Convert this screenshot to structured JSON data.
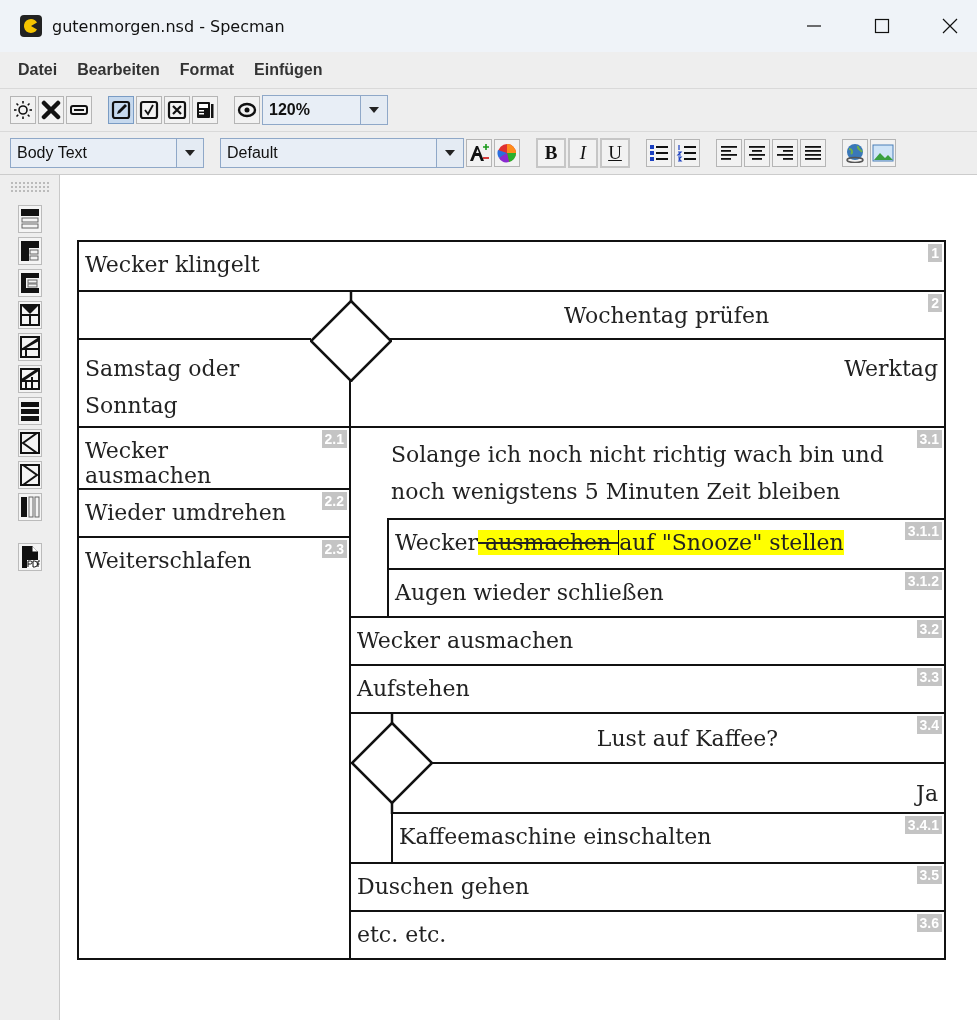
{
  "window": {
    "title": "gutenmorgen.nsd - Specman"
  },
  "menu": [
    "Datei",
    "Bearbeiten",
    "Format",
    "Einfügen"
  ],
  "toolbar": {
    "tools": [
      {
        "selected": false
      },
      {
        "selected": false
      },
      {
        "selected": false
      },
      {
        "selected": true
      },
      {
        "selected": false
      },
      {
        "selected": false
      },
      {
        "selected": false
      },
      {
        "selected": false
      }
    ],
    "zoom": "120%"
  },
  "format_bar": {
    "paragraph_style": "Body Text",
    "font": "Default",
    "style_buttons": [
      "B",
      "I",
      "U"
    ]
  },
  "diagram": {
    "blocks": [
      {
        "kind": "action",
        "number": "1",
        "text": "Wecker klingelt"
      },
      {
        "kind": "branch",
        "number": "2",
        "question": "Wochentag prüfen",
        "left_label": "Samstag oder Sonntag",
        "right_label": "Werktag",
        "left": [
          {
            "kind": "action",
            "number": "2.1",
            "text": "Wecker ausmachen"
          },
          {
            "kind": "action",
            "number": "2.2",
            "text": "Wieder umdrehen"
          },
          {
            "kind": "action",
            "number": "2.3",
            "text": "Weiterschlafen"
          }
        ],
        "right": [
          {
            "kind": "loop",
            "number": "3.1",
            "text": "Solange ich noch nicht richtig wach bin und noch wenigstens 5 Minuten Zeit bleiben",
            "body": [
              {
                "kind": "edited",
                "number": "3.1.1",
                "segments": [
                  {
                    "kind": "plain",
                    "text": "Wecker",
                    "cursor": false
                  },
                  {
                    "kind": "deleted",
                    "text": " ausmachen ",
                    "cursor": false
                  },
                  {
                    "kind": "inserted",
                    "text": "auf \"Snooze\" stellen",
                    "cursor": true
                  }
                ]
              },
              {
                "kind": "action",
                "number": "3.1.2",
                "text": "Augen wieder schließen"
              }
            ]
          },
          {
            "kind": "action",
            "number": "3.2",
            "text": "Wecker ausmachen"
          },
          {
            "kind": "action",
            "number": "3.3",
            "text": "Aufstehen"
          },
          {
            "kind": "if",
            "number": "3.4",
            "question": "Lust auf Kaffee?",
            "yes_label": "Ja",
            "body": [
              {
                "kind": "action",
                "number": "3.4.1",
                "text": "Kaffeemaschine einschalten"
              }
            ]
          },
          {
            "kind": "action",
            "number": "3.5",
            "text": "Duschen gehen"
          },
          {
            "kind": "action",
            "number": "3.6",
            "text": "etc. etc."
          }
        ]
      }
    ]
  }
}
